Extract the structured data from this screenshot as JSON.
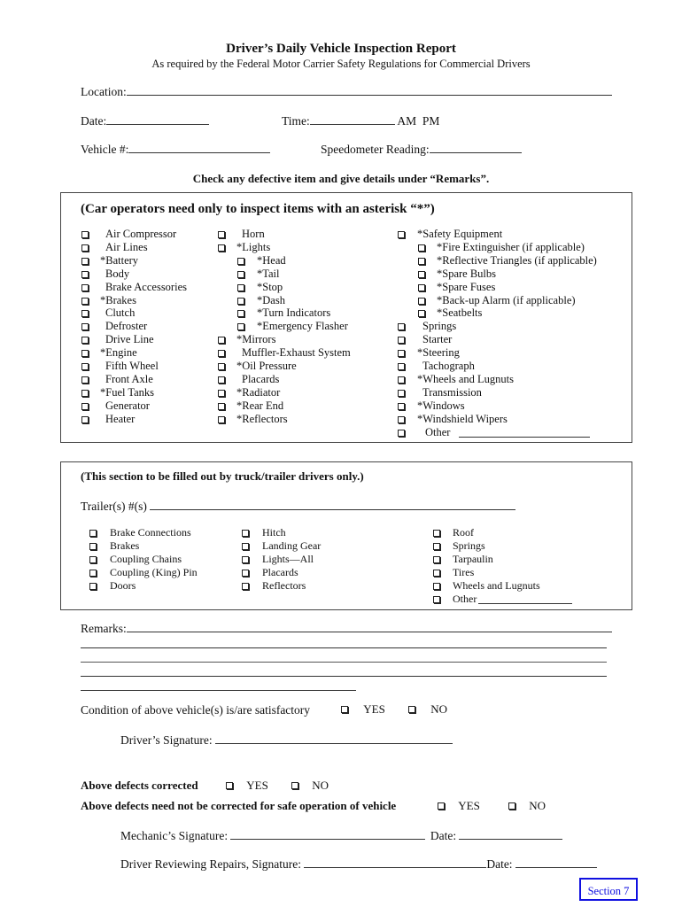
{
  "header": {
    "title": "Driver’s Daily Vehicle Inspection Report",
    "subtitle": "As required by the Federal Motor Carrier Safety Regulations for Commercial Drivers"
  },
  "fields": {
    "location_label": "Location:",
    "location_value": "",
    "date_label": "Date:",
    "date_value": "",
    "time_label": "Time:",
    "time_value": "",
    "am_pm_label": "AM  PM",
    "vehicle_label": "Vehicle #:",
    "vehicle_value": "",
    "speedometer_label": "Speedometer Reading:",
    "speedometer_value": ""
  },
  "instructions": "Check any defective item and give details under “Remarks”.",
  "car_section": {
    "heading": "(Car operators need only to inspect items with an asterisk “*”)",
    "col1": [
      {
        "label": "Air Compressor",
        "asterisk": false
      },
      {
        "label": "Air Lines",
        "asterisk": false
      },
      {
        "label": "*Battery",
        "asterisk": true
      },
      {
        "label": "Body",
        "asterisk": false
      },
      {
        "label": "Brake Accessories",
        "asterisk": false
      },
      {
        "label": "*Brakes",
        "asterisk": true
      },
      {
        "label": "Clutch",
        "asterisk": false
      },
      {
        "label": "Defroster",
        "asterisk": false
      },
      {
        "label": "Drive Line",
        "asterisk": false
      },
      {
        "label": "*Engine",
        "asterisk": true
      },
      {
        "label": "Fifth Wheel",
        "asterisk": false
      },
      {
        "label": "Front Axle",
        "asterisk": false
      },
      {
        "label": "*Fuel Tanks",
        "asterisk": true
      },
      {
        "label": "Generator",
        "asterisk": false
      },
      {
        "label": "Heater",
        "asterisk": false
      }
    ],
    "col2": [
      {
        "label": "Horn",
        "indent": 0
      },
      {
        "label": "*Lights",
        "indent": 0
      },
      {
        "label": "*Head",
        "indent": 1
      },
      {
        "label": "*Tail",
        "indent": 1
      },
      {
        "label": "*Stop",
        "indent": 1
      },
      {
        "label": "*Dash",
        "indent": 1
      },
      {
        "label": "*Turn Indicators",
        "indent": 1
      },
      {
        "label": "*Emergency Flasher",
        "indent": 1
      },
      {
        "label": "*Mirrors",
        "indent": 0
      },
      {
        "label": "Muffler-Exhaust System",
        "indent": 0
      },
      {
        "label": "*Oil Pressure",
        "indent": 0
      },
      {
        "label": "Placards",
        "indent": 0
      },
      {
        "label": "*Radiator",
        "indent": 0
      },
      {
        "label": "*Rear End",
        "indent": 0
      },
      {
        "label": "*Reflectors",
        "indent": 0
      }
    ],
    "col3": [
      {
        "label": "*Safety Equipment",
        "indent": 0
      },
      {
        "label": "*Fire Extinguisher (if applicable)",
        "indent": 1
      },
      {
        "label": "*Reflective Triangles (if applicable)",
        "indent": 1
      },
      {
        "label": "*Spare Bulbs",
        "indent": 1
      },
      {
        "label": "*Spare Fuses",
        "indent": 1
      },
      {
        "label": "*Back-up Alarm (if applicable)",
        "indent": 1
      },
      {
        "label": "*Seatbelts",
        "indent": 1
      },
      {
        "label": "Springs",
        "indent": 0
      },
      {
        "label": "Starter",
        "indent": 0
      },
      {
        "label": "*Steering",
        "indent": 0
      },
      {
        "label": "Tachograph",
        "indent": 0
      },
      {
        "label": "*Wheels and Lugnuts",
        "indent": 0
      },
      {
        "label": "Transmission",
        "indent": 0
      },
      {
        "label": "*Windows",
        "indent": 0
      },
      {
        "label": "*Windshield Wipers",
        "indent": 0
      },
      {
        "label": "Other",
        "indent": 0,
        "other": true
      }
    ]
  },
  "trailer_section": {
    "heading": "(This section to be filled out by truck/trailer drivers only.)",
    "trailer_label": "Trailer(s) #(s)",
    "trailer_value": "",
    "col1": [
      "Brake Connections",
      "Brakes",
      "Coupling Chains",
      "Coupling (King) Pin",
      "Doors"
    ],
    "col2": [
      "Hitch",
      "Landing Gear",
      "Lights—All",
      "Placards",
      "Reflectors"
    ],
    "col3": [
      "Roof",
      "Springs",
      "Tarpaulin",
      "Tires",
      "Wheels and Lugnuts",
      "Other"
    ]
  },
  "remarks": {
    "label": "Remarks:",
    "value": ""
  },
  "condition": {
    "label": "Condition of above vehicle(s) is/are satisfactory",
    "yes": "YES",
    "no": "NO"
  },
  "driver_signature_label": "Driver’s Signature:",
  "defects_corrected": {
    "label": "Above defects corrected",
    "yes": "YES",
    "no": "NO"
  },
  "defects_not_needed": {
    "label": "Above defects need not be corrected for safe operation of vehicle",
    "yes": "YES",
    "no": "NO"
  },
  "mechanic_signature_label": "Mechanic’s Signature:",
  "mechanic_date_label": "Date:",
  "driver_review_label": "Driver Reviewing Repairs, Signature:",
  "driver_review_date_label": "Date:",
  "section_badge": "Section 7",
  "colors": {
    "badge": "#1010e0",
    "border": "#444444",
    "text": "#111111"
  }
}
